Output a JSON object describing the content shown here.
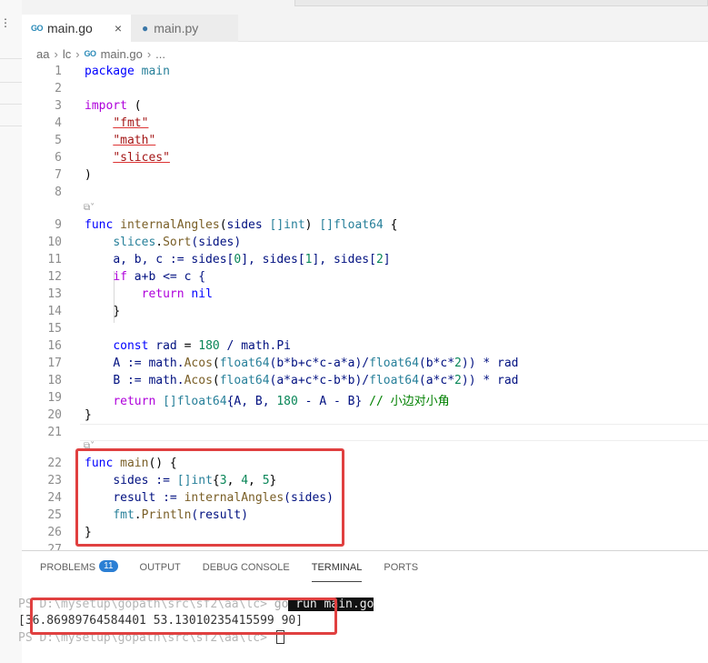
{
  "tabs": [
    {
      "label": "main.go",
      "icon": "go-icon",
      "active": true,
      "close": "×"
    },
    {
      "label": "main.py",
      "icon": "python-icon",
      "active": false
    }
  ],
  "icons": {
    "go": "GO",
    "python": "●"
  },
  "breadcrumb": [
    "aa",
    "lc",
    "main.go",
    "..."
  ],
  "editor": {
    "line_numbers": [
      "1",
      "2",
      "3",
      "4",
      "5",
      "6",
      "7",
      "8",
      "9",
      "10",
      "11",
      "12",
      "13",
      "14",
      "15",
      "16",
      "17",
      "18",
      "19",
      "20",
      "21",
      "22",
      "23",
      "24",
      "25",
      "26",
      "27"
    ],
    "hint_glyph": "⧉˅",
    "code": {
      "l1": {
        "kw": "package",
        "name": "main"
      },
      "l3": {
        "kw": "import",
        "paren": "("
      },
      "l4": "\"fmt\"",
      "l5": "\"math\"",
      "l6": "\"slices\"",
      "l7": ")",
      "l9": {
        "kw": "func",
        "name": "internalAngles",
        "p1": "(",
        "param": "sides",
        "ptype": " []int",
        "p2": ") ",
        "ret": "[]float64",
        "brace": " {"
      },
      "l10": {
        "pkg": "slices",
        "dot": ".",
        "fn": "Sort",
        "args": "(sides)"
      },
      "l11": {
        "text": "a, b, c := sides[",
        "n0": "0",
        "m1": "], sides[",
        "n1": "1",
        "m2": "], sides[",
        "n2": "2",
        "m3": "]"
      },
      "l12": {
        "kw": "if",
        "cond": " a+b <= c {"
      },
      "l13": {
        "kw": "return",
        "val": " nil"
      },
      "l14": "}",
      "l16": {
        "kw": "const",
        "name": " rad",
        "op": " = ",
        "num": "180",
        "rest": " / math.Pi"
      },
      "l17": {
        "lhs": "A := math.",
        "fn": "Acos",
        "a1": "(",
        "t1": "float64",
        "e1": "(b*b+c*c-a*a)/",
        "t2": "float64",
        "e2": "(b*c*",
        "n": "2",
        "e3": ")) * rad"
      },
      "l18": {
        "lhs": "B := math.",
        "fn": "Acos",
        "a1": "(",
        "t1": "float64",
        "e1": "(a*a+c*c-b*b)/",
        "t2": "float64",
        "e2": "(a*c*",
        "n": "2",
        "e3": ")) * rad"
      },
      "l19": {
        "kw": "return",
        "ty": " []float64",
        "b1": "{A, B, ",
        "num": "180",
        "b2": " - A - B}",
        "cmt": " // 小边对小角"
      },
      "l20": "}",
      "l22": {
        "kw": "func",
        "name": " main",
        "rest": "() {"
      },
      "l23": {
        "lhs": "sides := ",
        "ty": "[]int",
        "o": "{",
        "n1": "3",
        "c1": ", ",
        "n2": "4",
        "c2": ", ",
        "n3": "5",
        "c": "}"
      },
      "l24": {
        "lhs": "result := ",
        "fn": "internalAngles",
        "args": "(sides)"
      },
      "l25": {
        "pkg": "fmt",
        "dot": ".",
        "fn": "Println",
        "args": "(result)"
      },
      "l26": "}"
    }
  },
  "panel": {
    "tabs": [
      "PROBLEMS",
      "OUTPUT",
      "DEBUG CONSOLE",
      "TERMINAL",
      "PORTS"
    ],
    "problems_count": "11",
    "active_tab": "TERMINAL"
  },
  "terminal": {
    "line1_prompt": "PS D:\\mysetup\\gopath\\src\\sf2\\aa\\lc> ",
    "line1_cmd_a": "go",
    "line1_cmd_b": " run main.go",
    "line2": "[36.86989764584401 53.13010235415599 90]",
    "line3_prompt": "PS D:\\mysetup\\gopath\\src\\sf2\\aa\\lc> "
  },
  "colors": {
    "highlight_box": "#e04040",
    "badge": "#2b7fd4"
  }
}
